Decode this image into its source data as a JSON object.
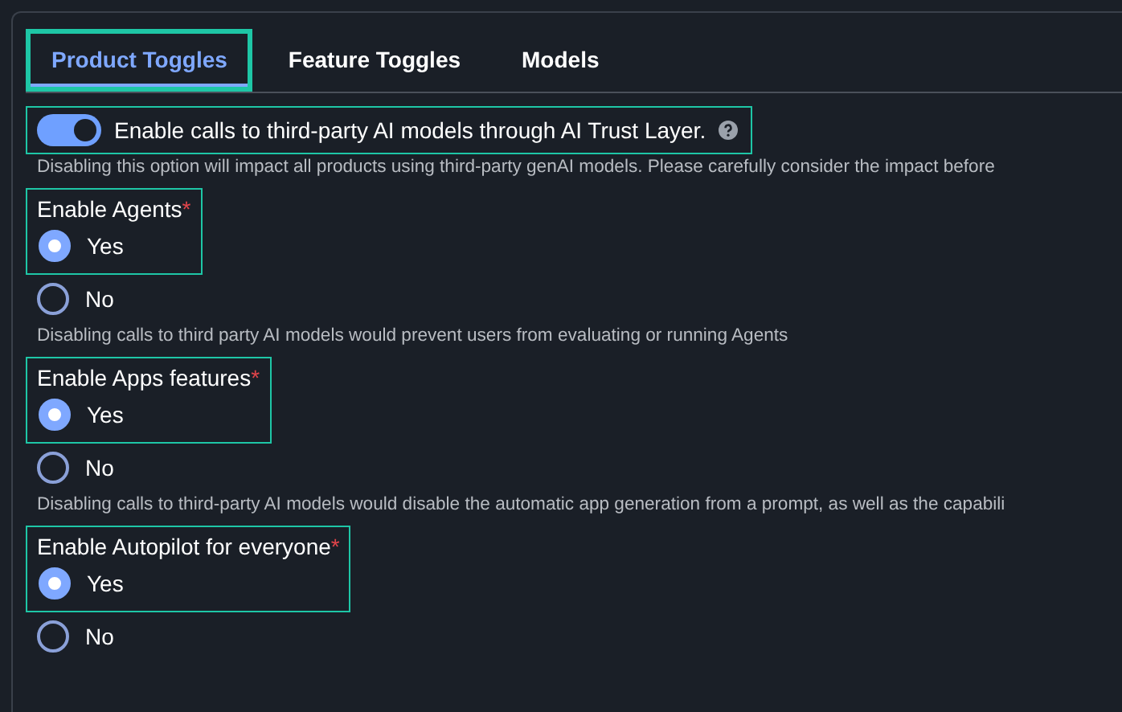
{
  "tabs": [
    {
      "label": "Product Toggles",
      "selected": true,
      "highlighted": true
    },
    {
      "label": "Feature Toggles",
      "selected": false,
      "highlighted": false
    },
    {
      "label": "Models",
      "selected": false,
      "highlighted": false
    }
  ],
  "master_toggle": {
    "label": "Enable calls to third-party AI models through AI Trust Layer.",
    "on": true,
    "highlighted": true,
    "description": "Disabling this option will impact all products using third-party genAI models. Please carefully consider the impact before"
  },
  "settings": [
    {
      "label": "Enable Agents",
      "required_mark": "*",
      "highlighted": true,
      "options": [
        {
          "label": "Yes",
          "selected": true
        },
        {
          "label": "No",
          "selected": false
        }
      ],
      "description": "Disabling calls to third party AI models would prevent users from evaluating or running Agents"
    },
    {
      "label": "Enable Apps features",
      "required_mark": "*",
      "highlighted": true,
      "options": [
        {
          "label": "Yes",
          "selected": true
        },
        {
          "label": "No",
          "selected": false
        }
      ],
      "description": "Disabling calls to third-party AI models would disable the automatic app generation from a prompt, as well as the capabili"
    },
    {
      "label": "Enable Autopilot for everyone",
      "required_mark": "*",
      "highlighted": true,
      "options": [
        {
          "label": "Yes",
          "selected": true
        },
        {
          "label": "No",
          "selected": false
        }
      ]
    }
  ]
}
